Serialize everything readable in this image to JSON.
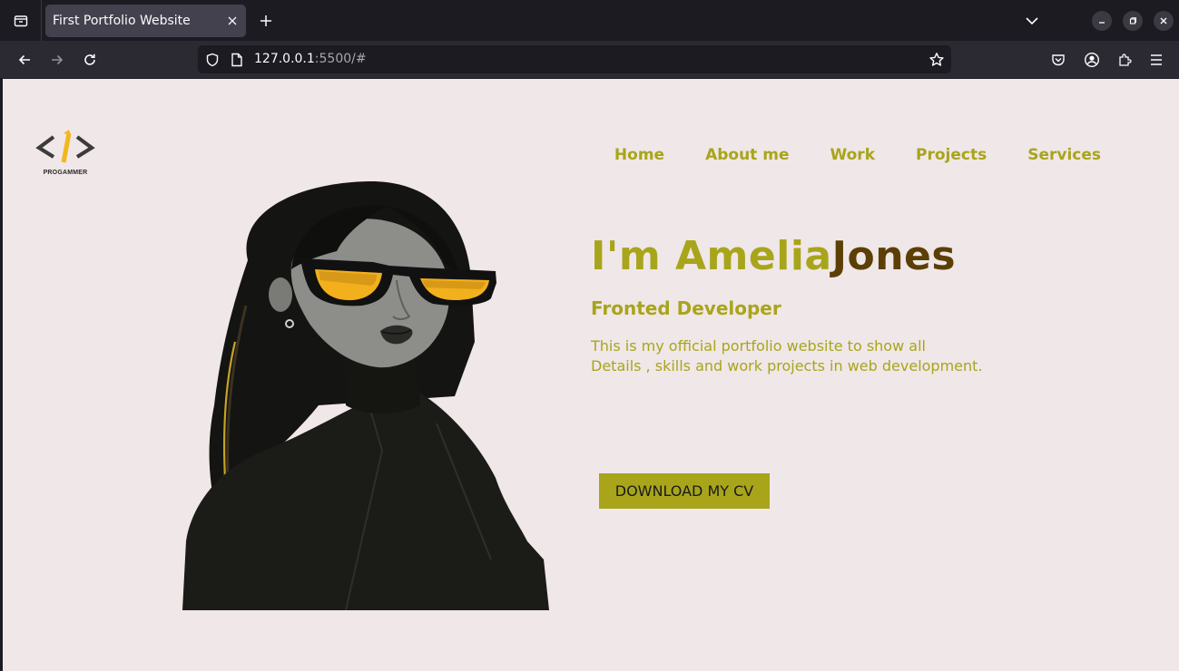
{
  "browser": {
    "tab_title": "First Portfolio Website",
    "url_host": "127.0.0.1",
    "url_rest": ":5500/#"
  },
  "logo": {
    "text": "PROGAMMER"
  },
  "nav": {
    "links": [
      {
        "label": "Home"
      },
      {
        "label": "About me"
      },
      {
        "label": "Work"
      },
      {
        "label": "Projects"
      },
      {
        "label": "Services"
      }
    ]
  },
  "hero": {
    "title_first": "I'm Amelia",
    "title_last": "Jones",
    "role": "Fronted Developer",
    "desc_line1": "This is my official portfolio website to show all",
    "desc_line2": "Details , skills and work projects in web development.",
    "cta_label": "DOWNLOAD MY CV"
  },
  "colors": {
    "accent": "#a8a51b",
    "last_name": "#5c3f05",
    "page_bg": "#f0e7e8",
    "chrome_dark": "#1c1b22"
  }
}
